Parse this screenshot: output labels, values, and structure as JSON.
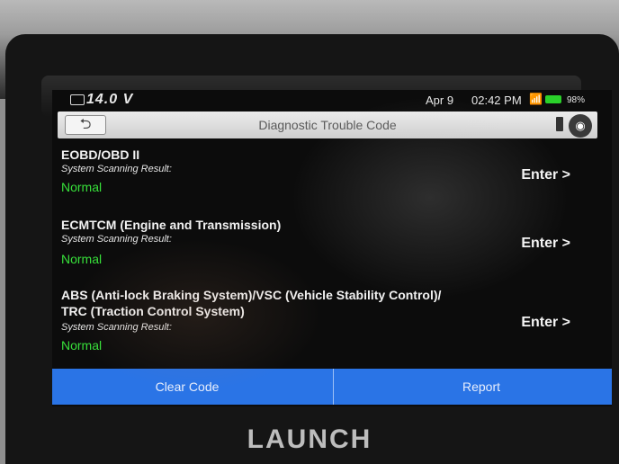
{
  "status_bar": {
    "voltage": "14.0 V",
    "date": "Apr 9",
    "time": "02:42 PM",
    "wifi_icon": "wifi-icon",
    "battery_percent": "98%"
  },
  "header": {
    "back_icon": "⮌",
    "title": "Diagnostic Trouble Code",
    "camera_icon": "◉"
  },
  "systems": [
    {
      "name_line1": "EOBD/OBD II",
      "name_line2": "",
      "scan_label": "System Scanning Result:",
      "result": "Normal",
      "enter_label": "Enter >"
    },
    {
      "name_line1": "ECMTCM (Engine and Transmission)",
      "name_line2": "",
      "scan_label": "System Scanning Result:",
      "result": "Normal",
      "enter_label": "Enter >"
    },
    {
      "name_line1": "ABS (Anti-lock Braking System)/VSC (Vehicle Stability Control)/",
      "name_line2": "TRC (Traction Control System)",
      "scan_label": "System Scanning Result:",
      "result": "Normal",
      "enter_label": "Enter >"
    }
  ],
  "footer": {
    "clear_label": "Clear Code",
    "report_label": "Report"
  },
  "brand": "LAUNCH",
  "colors": {
    "accent": "#2a74e6",
    "normal_status": "#37e03a"
  }
}
